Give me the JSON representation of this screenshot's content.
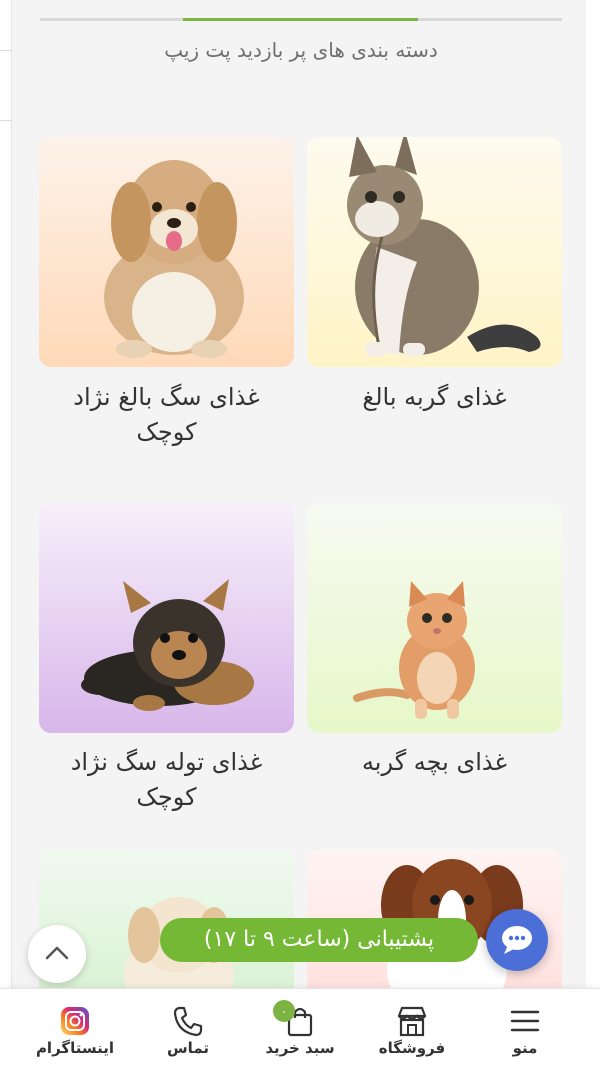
{
  "section": {
    "title": "دسته بندی های پر بازدید پت زیپ"
  },
  "categories": [
    {
      "label": "غذای گربه بالغ",
      "image": "adult-cat-image",
      "bg_top": "#fdfbf0",
      "bg_bottom": "#fff4c6"
    },
    {
      "label": "غذای سگ بالغ نژاد کوچک",
      "label_line1": "غذای سگ بالغ نژاد",
      "label_line2": "کوچک",
      "image": "adult-small-dog-image",
      "bg_top": "#fdf3ea",
      "bg_bottom": "#ffd9b8"
    },
    {
      "label": "غذای بچه گربه",
      "image": "kitten-image",
      "bg_top": "#f7faf2",
      "bg_bottom": "#e6f8c8"
    },
    {
      "label": "غذای توله سگ نژاد کوچک",
      "label_line1": "غذای توله سگ نژاد",
      "label_line2": "کوچک",
      "image": "puppy-image",
      "bg_top": "#f6f0fa",
      "bg_bottom": "#d8b6ea"
    },
    {
      "label": "",
      "image": "dog-image",
      "bg_top": "#fef4f3",
      "bg_bottom": "#ffe0de"
    },
    {
      "label": "",
      "image": "puppy-image-2",
      "bg_top": "#f1faf0",
      "bg_bottom": "#d9f2d3"
    }
  ],
  "floating": {
    "support_label": "پشتیبانی (ساعت ۹ تا ۱۷)",
    "chat_icon": "chat-bubble-icon",
    "scroll_top_icon": "chevron-up-icon"
  },
  "bottom_nav": {
    "items": [
      {
        "label": "منو",
        "icon": "menu-icon"
      },
      {
        "label": "فروشگاه",
        "icon": "store-icon"
      },
      {
        "label": "سبد خرید",
        "icon": "shopping-bag-icon",
        "badge": "۰"
      },
      {
        "label": "تماس",
        "icon": "phone-icon"
      },
      {
        "label": "اینستاگرام",
        "icon": "instagram-icon"
      }
    ]
  },
  "colors": {
    "accent": "#7cb342",
    "support": "#75b836",
    "chat": "#4b6fd6",
    "panel_bg": "#f4f4f4"
  }
}
